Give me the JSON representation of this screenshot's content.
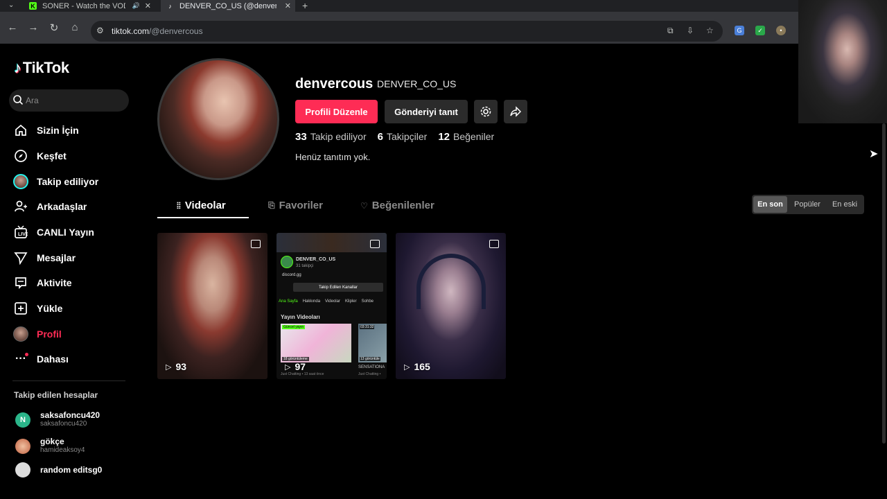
{
  "browser": {
    "tabs": [
      {
        "title": "SONER - Watch the VOD on",
        "favicon": "K"
      },
      {
        "title": "DENVER_CO_US (@denvercous)",
        "favicon": "tiktok"
      }
    ],
    "url_host": "tiktok.com",
    "url_path": "/@denvercous"
  },
  "sidebar": {
    "logo": "TikTok",
    "search_placeholder": "Ara",
    "items": [
      {
        "label": "Sizin İçin",
        "icon": "home-icon"
      },
      {
        "label": "Keşfet",
        "icon": "compass-icon"
      },
      {
        "label": "Takip ediliyor",
        "icon": "avatar"
      },
      {
        "label": "Arkadaşlar",
        "icon": "friends-icon"
      },
      {
        "label": "CANLI Yayın",
        "icon": "live-icon"
      },
      {
        "label": "Mesajlar",
        "icon": "messages-icon"
      },
      {
        "label": "Aktivite",
        "icon": "activity-icon"
      },
      {
        "label": "Yükle",
        "icon": "upload-icon"
      },
      {
        "label": "Profil",
        "icon": "avatar"
      },
      {
        "label": "Dahası",
        "icon": "more-icon"
      }
    ],
    "following_title": "Takip edilen hesaplar",
    "accounts": [
      {
        "name": "saksafoncu420",
        "handle": "saksafoncu420",
        "initial": "N"
      },
      {
        "name": "gökçe",
        "handle": "hamideaksoy4",
        "initial": ""
      },
      {
        "name": "random editsg0",
        "handle": "",
        "initial": ""
      }
    ]
  },
  "profile": {
    "username": "denvercous",
    "nickname": "DENVER_CO_US",
    "edit_button": "Profili Düzenle",
    "promote_button": "Gönderiyi tanıt",
    "stats": [
      {
        "num": "33",
        "label": "Takip ediliyor"
      },
      {
        "num": "6",
        "label": "Takipçiler"
      },
      {
        "num": "12",
        "label": "Beğeniler"
      }
    ],
    "bio": "Henüz tanıtım yok."
  },
  "tabs": [
    {
      "label": "Videolar"
    },
    {
      "label": "Favoriler"
    },
    {
      "label": "Beğenilenler"
    }
  ],
  "sort": [
    "En son",
    "Popüler",
    "En eski"
  ],
  "videos": [
    {
      "views": "93"
    },
    {
      "views": "97"
    },
    {
      "views": "165"
    }
  ],
  "video2_screen": {
    "channel": "DENVER_CO_US",
    "followers": "31 takipçi",
    "link": "discord.gg",
    "follow_btn": "Takip Edilen Kanallar",
    "nav": [
      "Ana Sayfa",
      "Hakkında",
      "Videolar",
      "Klipler",
      "Sohbe"
    ],
    "section": "Yayın Videoları",
    "thumb1_tag": "Güncel yayın",
    "thumb1_views": "18 görüntüleme",
    "thumb2_time": "03:31:32",
    "thumb2_views": "13 görüntüle",
    "thumb2_title": "SENSATIONA",
    "meta1": "Just Chatting • 13 saat önce",
    "meta2": "Just Chatting •"
  },
  "colors": {
    "accent": "#fe2c55",
    "bg": "#000000"
  }
}
